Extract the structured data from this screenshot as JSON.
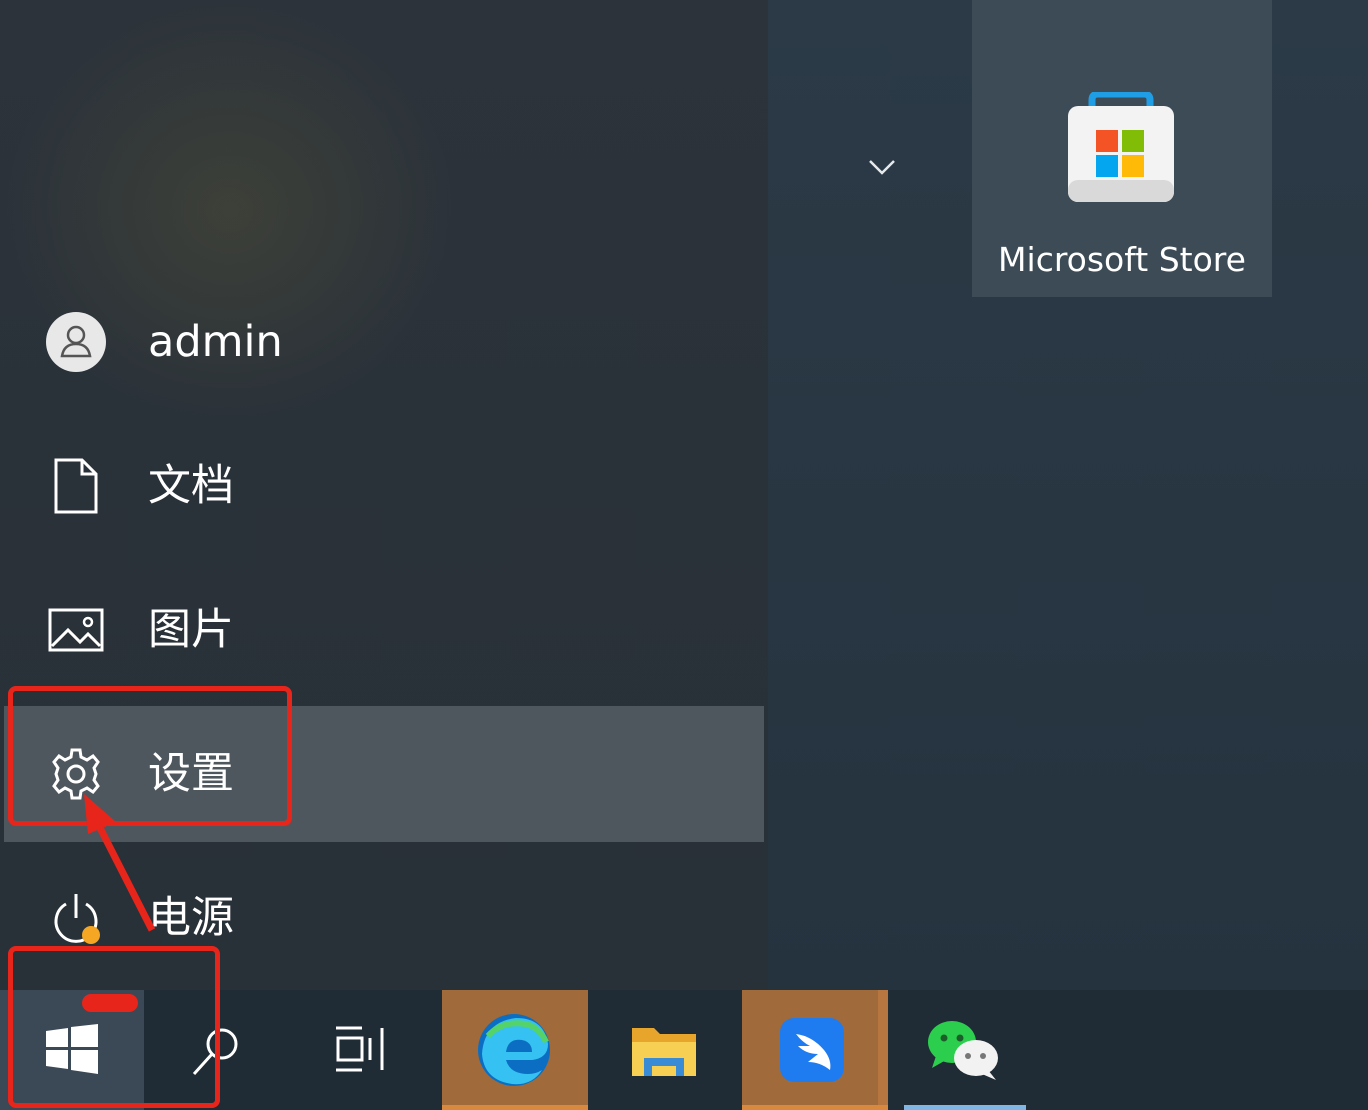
{
  "start_menu": {
    "user": {
      "label": "admin",
      "icon": "user-avatar-icon"
    },
    "items": [
      {
        "label": "文档",
        "icon": "document-icon"
      },
      {
        "label": "图片",
        "icon": "pictures-icon"
      },
      {
        "label": "设置",
        "icon": "gear-icon"
      },
      {
        "label": "电源",
        "icon": "power-icon"
      }
    ]
  },
  "tiles": [
    {
      "label": "Microsoft Store",
      "icon": "store-bag-icon"
    }
  ],
  "taskbar": {
    "buttons": [
      "windows-logo-icon",
      "search-icon",
      "task-view-icon",
      "edge-icon",
      "file-explorer-icon",
      "feishu-app-icon",
      "wechat-icon"
    ]
  },
  "colors": {
    "annotation": "#e8251b",
    "highlight": "#4f575e",
    "taskbar": "#1f2b35",
    "pinned_active": "#a06a3a"
  }
}
